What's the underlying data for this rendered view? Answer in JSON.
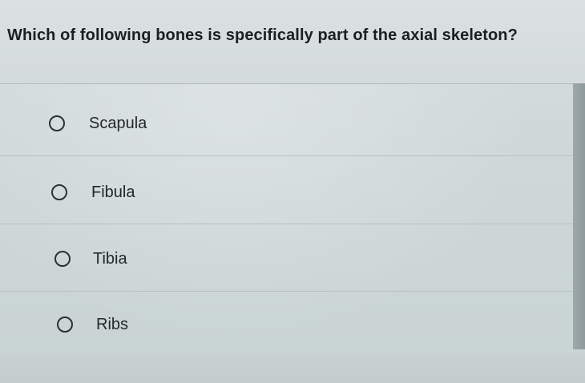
{
  "question": {
    "text": "Which of following bones is specifically part of the axial skeleton?"
  },
  "options": [
    {
      "label": "Scapula",
      "selected": false
    },
    {
      "label": "Fibula",
      "selected": false
    },
    {
      "label": "Tibia",
      "selected": false
    },
    {
      "label": "Ribs",
      "selected": false
    }
  ]
}
